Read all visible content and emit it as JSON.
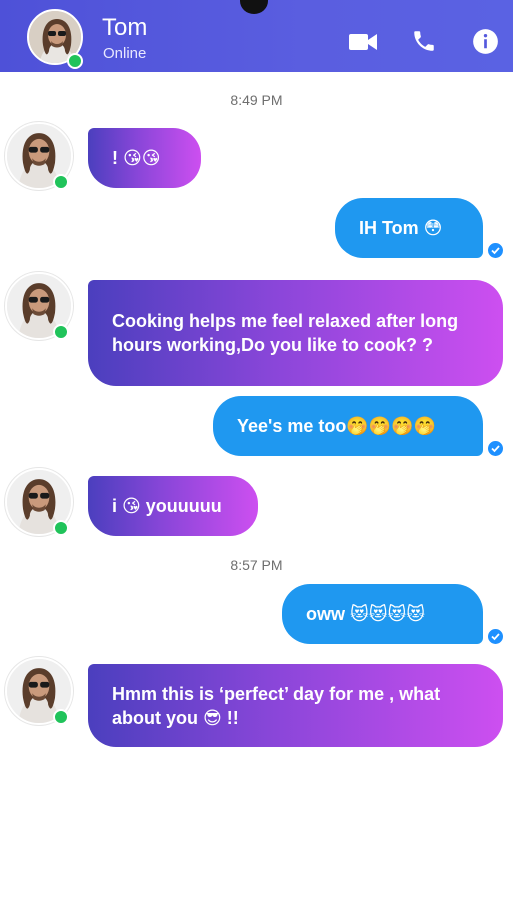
{
  "header": {
    "name": "Tom",
    "status": "Online",
    "icons": [
      "video-icon",
      "phone-icon",
      "info-icon"
    ],
    "accent": "#5559dd"
  },
  "timestamps": [
    "8:49 PM",
    "8:57 PM"
  ],
  "messages": [
    {
      "side": "in",
      "text": "! 😘😘"
    },
    {
      "side": "out",
      "text": "IH Tom 😳"
    },
    {
      "side": "in",
      "text": "Cooking helps me feel relaxed after long hours working,Do you like to cook? ?"
    },
    {
      "side": "out",
      "text": "Yee's me too🤭🤭🤭🤭"
    },
    {
      "side": "in",
      "text": "i 😘 youuuuu"
    },
    {
      "side": "out",
      "text": "oww 😻😻😻😻"
    },
    {
      "side": "in",
      "text": "Hmm this is ‘perfect’ day for me , what about you 😎 !!"
    }
  ],
  "colors": {
    "incoming_gradient_start": "#4b3fbe",
    "incoming_gradient_end": "#cd4ff0",
    "outgoing": "#1f98f0",
    "online": "#20c35a"
  }
}
